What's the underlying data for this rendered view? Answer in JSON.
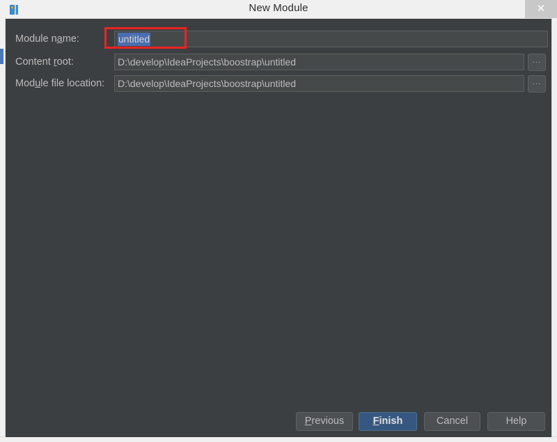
{
  "window": {
    "title": "New Module",
    "app_icon": "intellij-idea-icon",
    "close_label": "✕"
  },
  "form": {
    "rows": [
      {
        "label_pre": "Module n",
        "label_mnemonic": "a",
        "label_post": "me:",
        "value": "untitled",
        "selected": true,
        "has_browse": false
      },
      {
        "label_pre": "Content ",
        "label_mnemonic": "r",
        "label_post": "oot:",
        "value": "D:\\develop\\IdeaProjects\\boostrap\\untitled",
        "selected": false,
        "has_browse": true
      },
      {
        "label_pre": "Mod",
        "label_mnemonic": "u",
        "label_post": "le file location:",
        "value": "D:\\develop\\IdeaProjects\\boostrap\\untitled",
        "selected": false,
        "has_browse": true
      }
    ],
    "browse_label": "..."
  },
  "footer": {
    "buttons": [
      {
        "pre": "",
        "mnemonic": "P",
        "post": "revious",
        "default": false
      },
      {
        "pre": "",
        "mnemonic": "F",
        "post": "inish",
        "default": true
      },
      {
        "pre": "Cancel",
        "mnemonic": "",
        "post": "",
        "default": false
      },
      {
        "pre": "Help",
        "mnemonic": "",
        "post": "",
        "default": false
      }
    ]
  },
  "colors": {
    "panel_bg": "#3c3f41",
    "field_bg": "#45494a",
    "titlebar_bg": "#f0f0f0",
    "selection_blue": "#4b6eaf",
    "default_button_blue": "#365880",
    "annotation_red": "#ee2222",
    "text": "#bbbbbb"
  },
  "annotation": {
    "type": "red-rectangle-highlight",
    "target": "module-name-field"
  }
}
